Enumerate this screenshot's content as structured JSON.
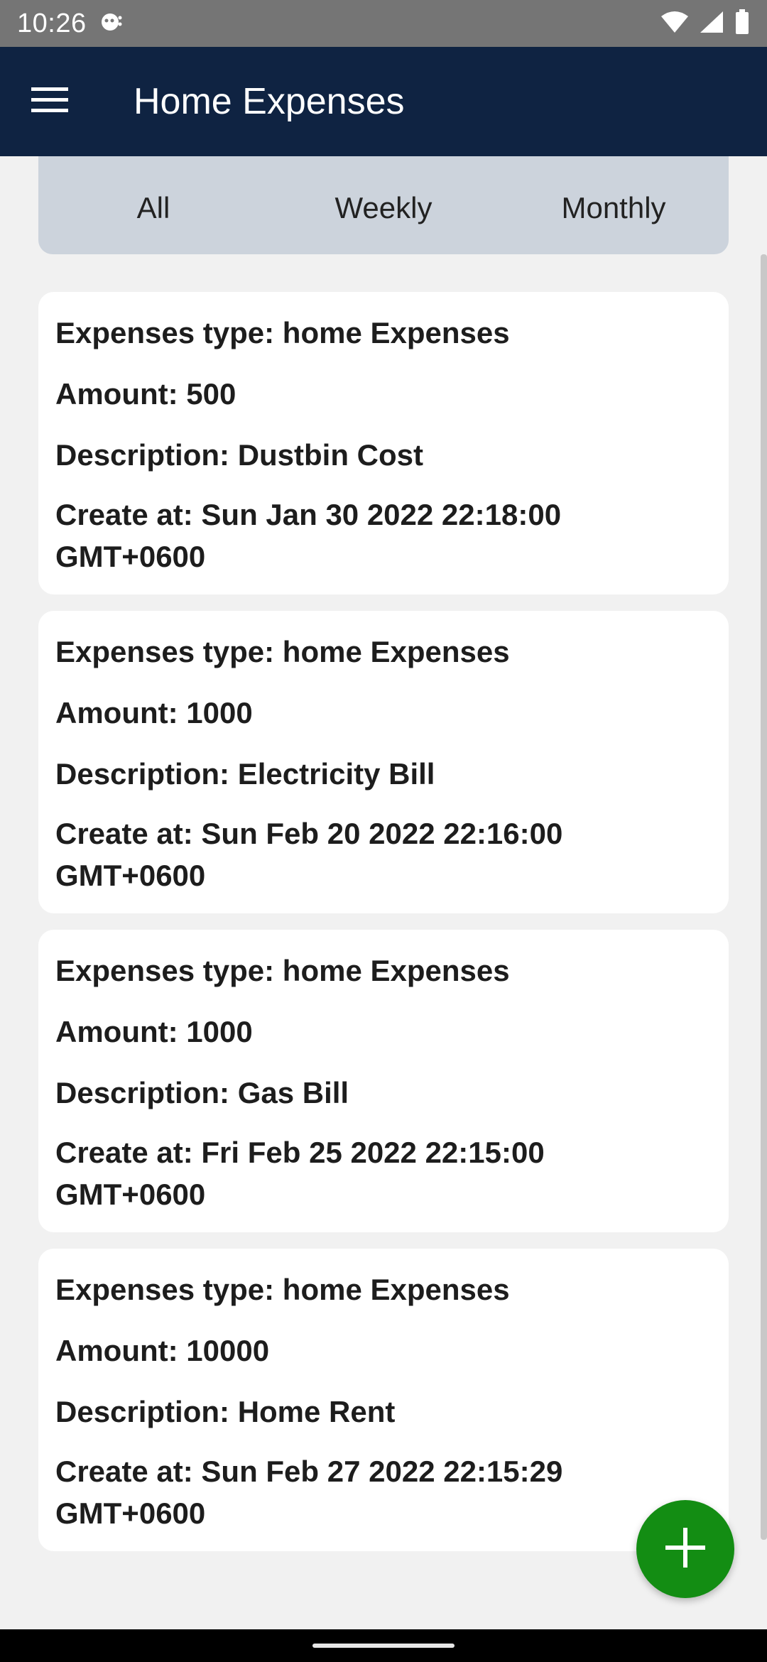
{
  "status_bar": {
    "time": "10:26",
    "icons": [
      "notification-icon",
      "wifi-icon",
      "signal-icon",
      "battery-icon"
    ]
  },
  "app_bar": {
    "title": "Home Expenses",
    "menu_icon": "hamburger-menu-icon",
    "background_color": "#0f2342"
  },
  "tabs": [
    {
      "label": "All"
    },
    {
      "label": "Weekly"
    },
    {
      "label": "Monthly"
    }
  ],
  "expenses": [
    {
      "type_text": "Expenses type: home Expenses",
      "amount_text": "Amount: 500",
      "description_text": "Description: Dustbin Cost",
      "created_text": "Create at: Sun Jan 30 2022 22:18:00 GMT+0600"
    },
    {
      "type_text": "Expenses type: home Expenses",
      "amount_text": "Amount: 1000",
      "description_text": "Description: Electricity Bill",
      "created_text": "Create at: Sun Feb 20 2022 22:16:00 GMT+0600"
    },
    {
      "type_text": "Expenses type: home Expenses",
      "amount_text": "Amount: 1000",
      "description_text": "Description: Gas Bill",
      "created_text": "Create at: Fri Feb 25 2022 22:15:00 GMT+0600"
    },
    {
      "type_text": "Expenses type: home Expenses",
      "amount_text": "Amount: 10000",
      "description_text": "Description: Home Rent",
      "created_text": "Create at: Sun Feb 27 2022 22:15:29 GMT+0600"
    }
  ],
  "fab": {
    "icon": "plus-icon",
    "color": "#138d13"
  }
}
